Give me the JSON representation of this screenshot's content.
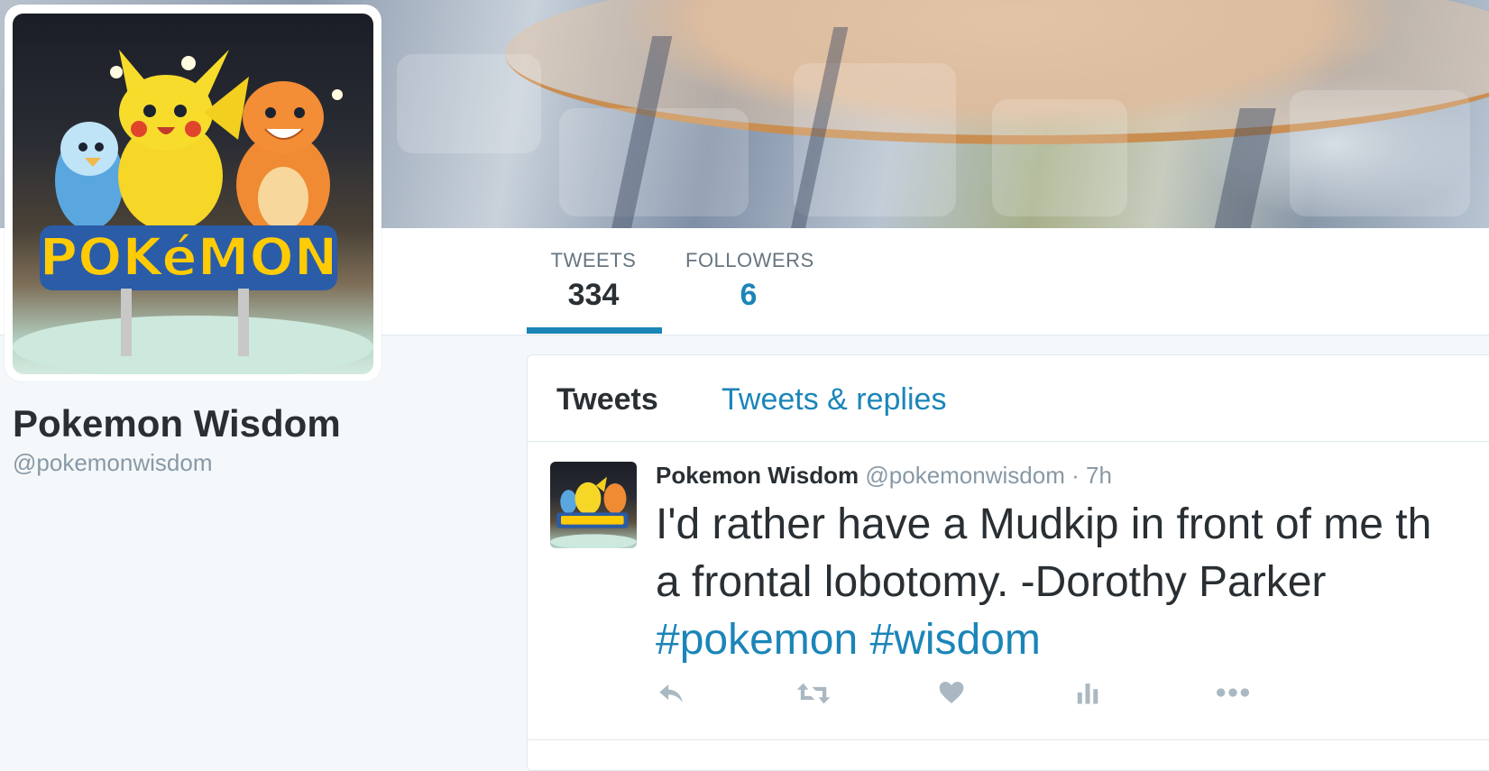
{
  "profile": {
    "name": "Pokemon Wisdom",
    "handle": "@pokemonwisdom",
    "avatar_logo_text": "POKéMON"
  },
  "nav": {
    "tweets_label": "TWEETS",
    "tweets_count": "334",
    "followers_label": "FOLLOWERS",
    "followers_count": "6",
    "active": "tweets"
  },
  "timeline": {
    "tabs": [
      {
        "label": "Tweets",
        "active": true
      },
      {
        "label": "Tweets & replies",
        "active": false
      }
    ],
    "tweets": [
      {
        "name": "Pokemon Wisdom",
        "handle": "@pokemonwisdom",
        "separator": "·",
        "time": "7h",
        "text_line1": "I'd rather have a Mudkip in front of me th",
        "text_line2": "a frontal lobotomy. -Dorothy Parker",
        "hashtags": [
          "#pokemon",
          "#wisdom"
        ],
        "actions": [
          "reply-icon",
          "retweet-icon",
          "like-icon",
          "analytics-icon",
          "more-icon"
        ]
      }
    ]
  },
  "colors": {
    "accent": "#1b85b8",
    "text": "#292f33",
    "muted": "#8899a6",
    "icon": "#aab8c2",
    "background": "#f5f8fa"
  }
}
